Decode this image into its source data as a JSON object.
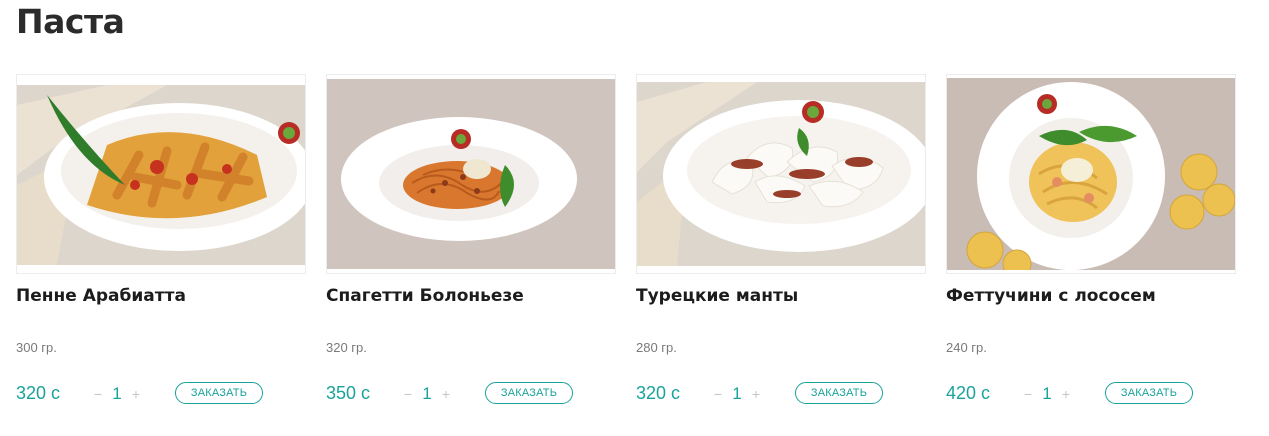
{
  "section": {
    "title": "Паста"
  },
  "items": [
    {
      "name": "Пенне Арабиатта",
      "weight": "300 гр.",
      "price": "320 с",
      "qty": "1",
      "minus": "−",
      "plus": "+",
      "button": "ЗАКАЗАТЬ",
      "image": "penne-arrabbiata-photo"
    },
    {
      "name": "Спагетти Болоньезе",
      "weight": "320 гр.",
      "price": "350 с",
      "qty": "1",
      "minus": "−",
      "plus": "+",
      "button": "ЗАКАЗАТЬ",
      "image": "spaghetti-bolognese-photo"
    },
    {
      "name": "Турецкие манты",
      "weight": "280 гр.",
      "price": "320 с",
      "qty": "1",
      "minus": "−",
      "plus": "+",
      "button": "ЗАКАЗАТЬ",
      "image": "turkish-manti-photo"
    },
    {
      "name": "Феттучини с лососем",
      "weight": "240 гр.",
      "price": "420 с",
      "qty": "1",
      "minus": "−",
      "plus": "+",
      "button": "ЗАКАЗАТЬ",
      "image": "fettuccine-salmon-photo"
    }
  ],
  "colors": {
    "accent": "#1aa39a",
    "title": "#2b2b2b",
    "muted": "#7a7a7a",
    "stepper": "#c4c4c4"
  }
}
